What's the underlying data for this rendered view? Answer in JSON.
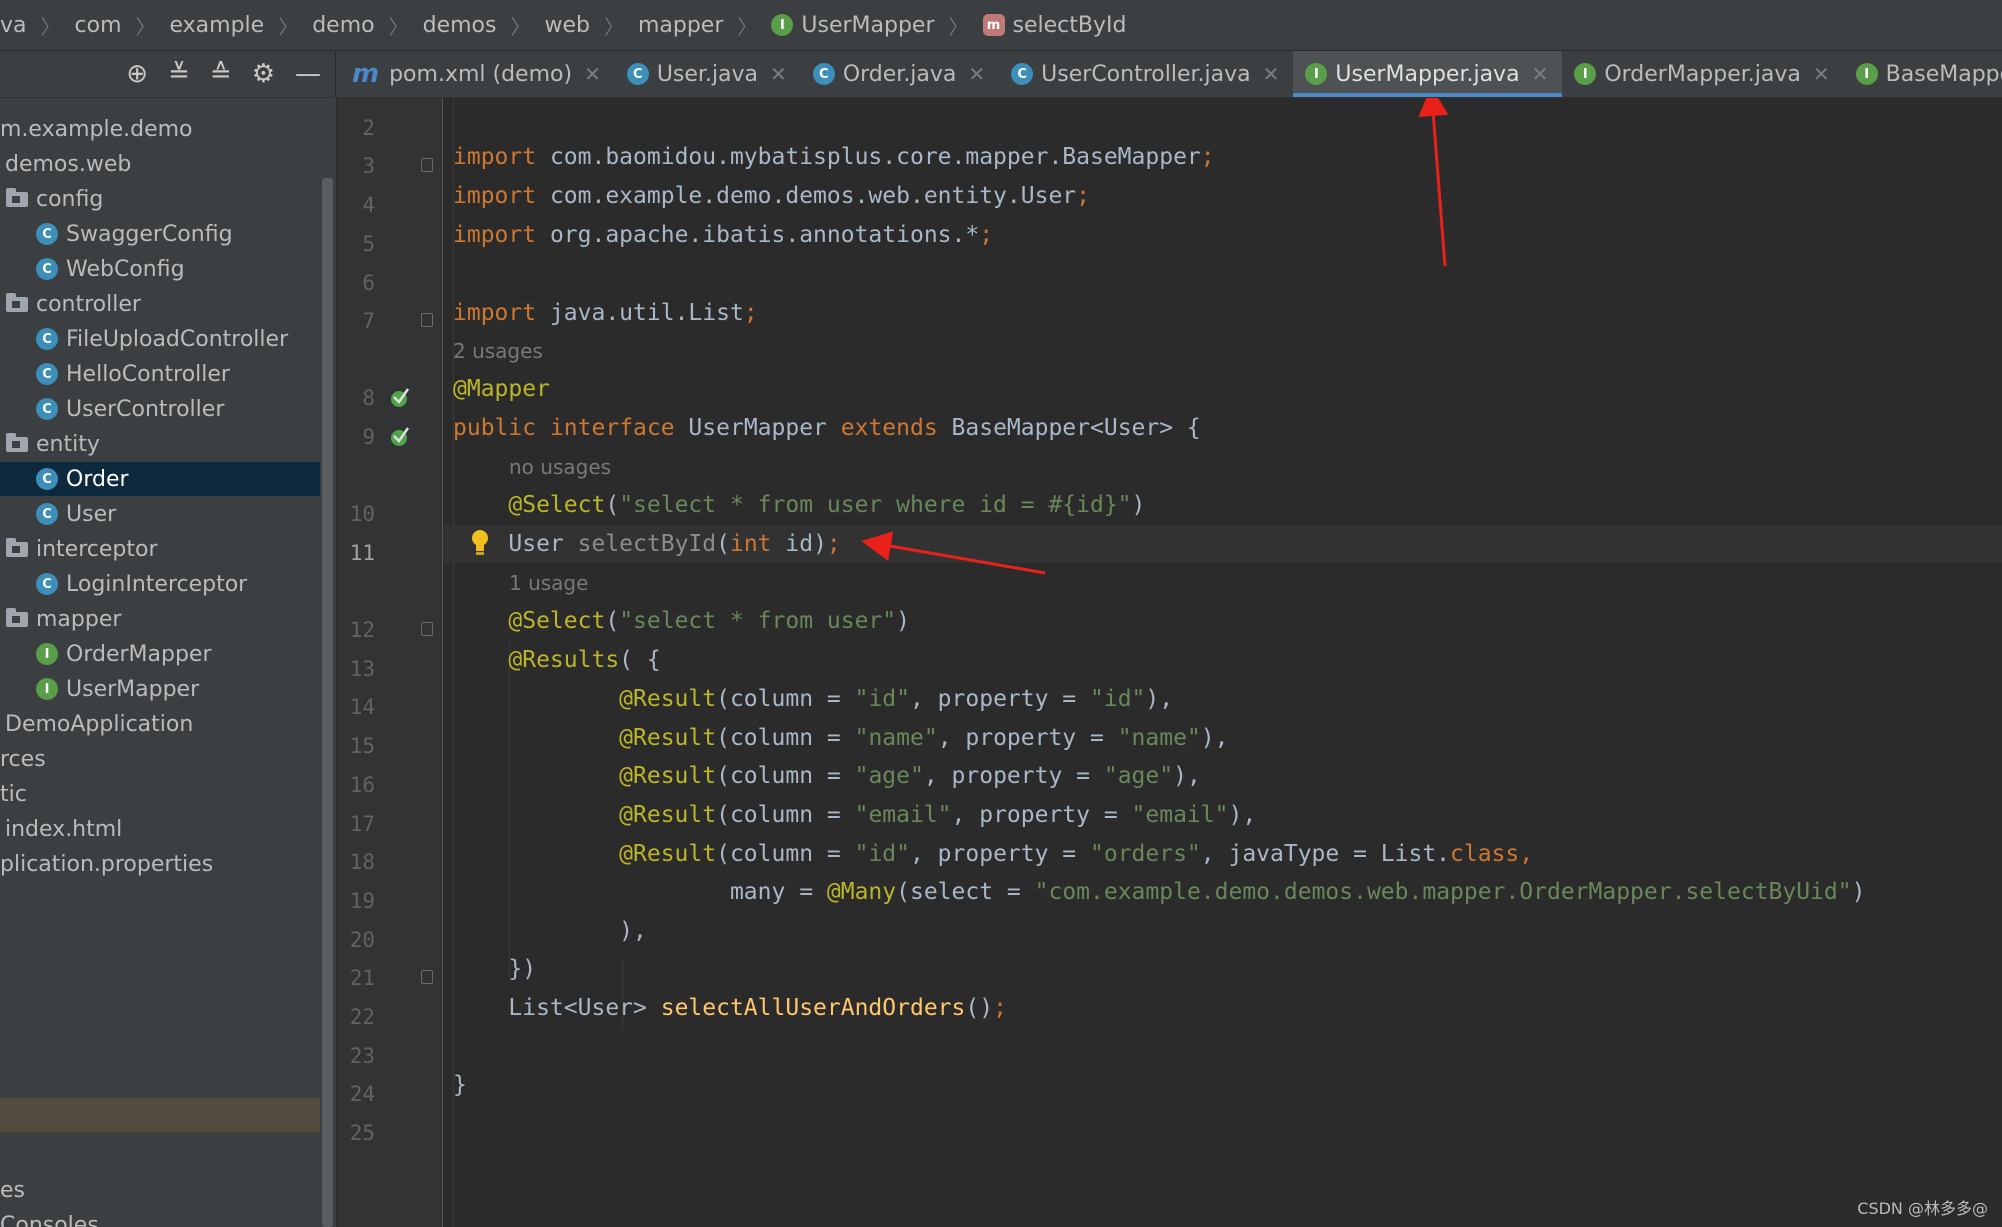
{
  "breadcrumb": [
    "va",
    "com",
    "example",
    "demo",
    "demos",
    "web",
    "mapper",
    "UserMapper",
    "selectById"
  ],
  "tabs": [
    {
      "label": "pom.xml (demo)",
      "icon": "maven-icon"
    },
    {
      "label": "User.java",
      "icon": "class-icon"
    },
    {
      "label": "Order.java",
      "icon": "class-icon"
    },
    {
      "label": "UserController.java",
      "icon": "class-icon"
    },
    {
      "label": "UserMapper.java",
      "icon": "interface-icon",
      "active": true
    },
    {
      "label": "OrderMapper.java",
      "icon": "interface-icon"
    },
    {
      "label": "BaseMapper.class",
      "icon": "interface-icon"
    }
  ],
  "tree": [
    {
      "label": "m.example.demo",
      "kind": "package",
      "indent": 0
    },
    {
      "label": "demos.web",
      "kind": "package",
      "indent": 1
    },
    {
      "label": "config",
      "kind": "folder",
      "indent": 1
    },
    {
      "label": "SwaggerConfig",
      "kind": "class",
      "indent": 2
    },
    {
      "label": "WebConfig",
      "kind": "class",
      "indent": 2
    },
    {
      "label": "controller",
      "kind": "folder",
      "indent": 1
    },
    {
      "label": "FileUploadController",
      "kind": "class",
      "indent": 2
    },
    {
      "label": "HelloController",
      "kind": "class",
      "indent": 2
    },
    {
      "label": "UserController",
      "kind": "class",
      "indent": 2
    },
    {
      "label": "entity",
      "kind": "folder",
      "indent": 1
    },
    {
      "label": "Order",
      "kind": "class",
      "indent": 2,
      "selected": true
    },
    {
      "label": "User",
      "kind": "class",
      "indent": 2
    },
    {
      "label": "interceptor",
      "kind": "folder",
      "indent": 1
    },
    {
      "label": "LoginInterceptor",
      "kind": "class",
      "indent": 2
    },
    {
      "label": "mapper",
      "kind": "folder",
      "indent": 1
    },
    {
      "label": "OrderMapper",
      "kind": "interface",
      "indent": 2
    },
    {
      "label": "UserMapper",
      "kind": "interface",
      "indent": 2
    },
    {
      "label": "DemoApplication",
      "kind": "text",
      "indent": 1
    },
    {
      "label": "rces",
      "kind": "text",
      "indent": 0
    },
    {
      "label": "tic",
      "kind": "text",
      "indent": 0
    },
    {
      "label": "index.html",
      "kind": "text",
      "indent": 1
    },
    {
      "label": "plication.properties",
      "kind": "text",
      "indent": 0
    }
  ],
  "tree_bottom": [
    "es",
    "Consoles"
  ],
  "hints": {
    "usages_2": "2 usages",
    "usages_0": "no usages",
    "usages_1": "1 usage"
  },
  "code": {
    "l3": {
      "kw": "import",
      "rest": " com.baomidou.mybatisplus.core.mapper.BaseMapper",
      "semi": ";"
    },
    "l4": {
      "kw": "import",
      "rest": " com.example.demo.demos.web.entity.User",
      "semi": ";"
    },
    "l5": {
      "kw": "import",
      "rest": " org.apache.ibatis.annotations.*",
      "semi": ";"
    },
    "l7": {
      "kw": "import",
      "rest": " java.util.List",
      "semi": ";"
    },
    "l8": {
      "an": "@Mapper"
    },
    "l9": {
      "kw1": "public",
      "kw2": "interface",
      "name": " UserMapper ",
      "kw3": "extends",
      "rest": " BaseMapper<User> {"
    },
    "l10": {
      "an": "@Select",
      "open": "(",
      "str": "\"select * from user where id = #{id}\"",
      "close": ")"
    },
    "l11": {
      "type": "User ",
      "method": "selectById",
      "open": "(",
      "kw": "int",
      "rest": " id)",
      "semi": ";"
    },
    "l12": {
      "an": "@Select",
      "open": "(",
      "str": "\"select * from user\"",
      "close": ")"
    },
    "l13": {
      "an": "@Results",
      "rest": "( {"
    },
    "l14": {
      "an": "@Result",
      "a": "(column = ",
      "s1": "\"id\"",
      "b": ", property = ",
      "s2": "\"id\"",
      "c": "),"
    },
    "l15": {
      "an": "@Result",
      "a": "(column = ",
      "s1": "\"name\"",
      "b": ", property = ",
      "s2": "\"name\"",
      "c": "),"
    },
    "l16": {
      "an": "@Result",
      "a": "(column = ",
      "s1": "\"age\"",
      "b": ", property = ",
      "s2": "\"age\"",
      "c": "),"
    },
    "l17": {
      "an": "@Result",
      "a": "(column = ",
      "s1": "\"email\"",
      "b": ", property = ",
      "s2": "\"email\"",
      "c": "),"
    },
    "l18": {
      "an": "@Result",
      "a": "(column = ",
      "s1": "\"id\"",
      "b": ", property = ",
      "s2": "\"orders\"",
      "c": ", javaType = List.",
      "kw": "class",
      "d": ","
    },
    "l19": {
      "a": "many = ",
      "an": "@Many",
      "b": "(select = ",
      "str": "\"com.example.demo.demos.web.mapper.OrderMapper.selectByUid\"",
      "c": ")"
    },
    "l20": {
      "a": "),"
    },
    "l21": {
      "a": "})"
    },
    "l22": {
      "a": "List<User> ",
      "method": "selectAllUserAndOrders",
      "b": "()",
      "semi": ";"
    },
    "l24": {
      "a": "}"
    }
  },
  "line_numbers": [
    "2",
    "3",
    "4",
    "5",
    "6",
    "7",
    "8",
    "9",
    "10",
    "11",
    "12",
    "13",
    "14",
    "15",
    "16",
    "17",
    "18",
    "19",
    "20",
    "21",
    "22",
    "23",
    "24",
    "25"
  ],
  "watermark": "CSDN @林多多@",
  "colors": {
    "keyword": "#cc7832",
    "annotation": "#bbb529",
    "string": "#6a8759",
    "method": "#ffc66d",
    "arrow": "#e8221b"
  }
}
